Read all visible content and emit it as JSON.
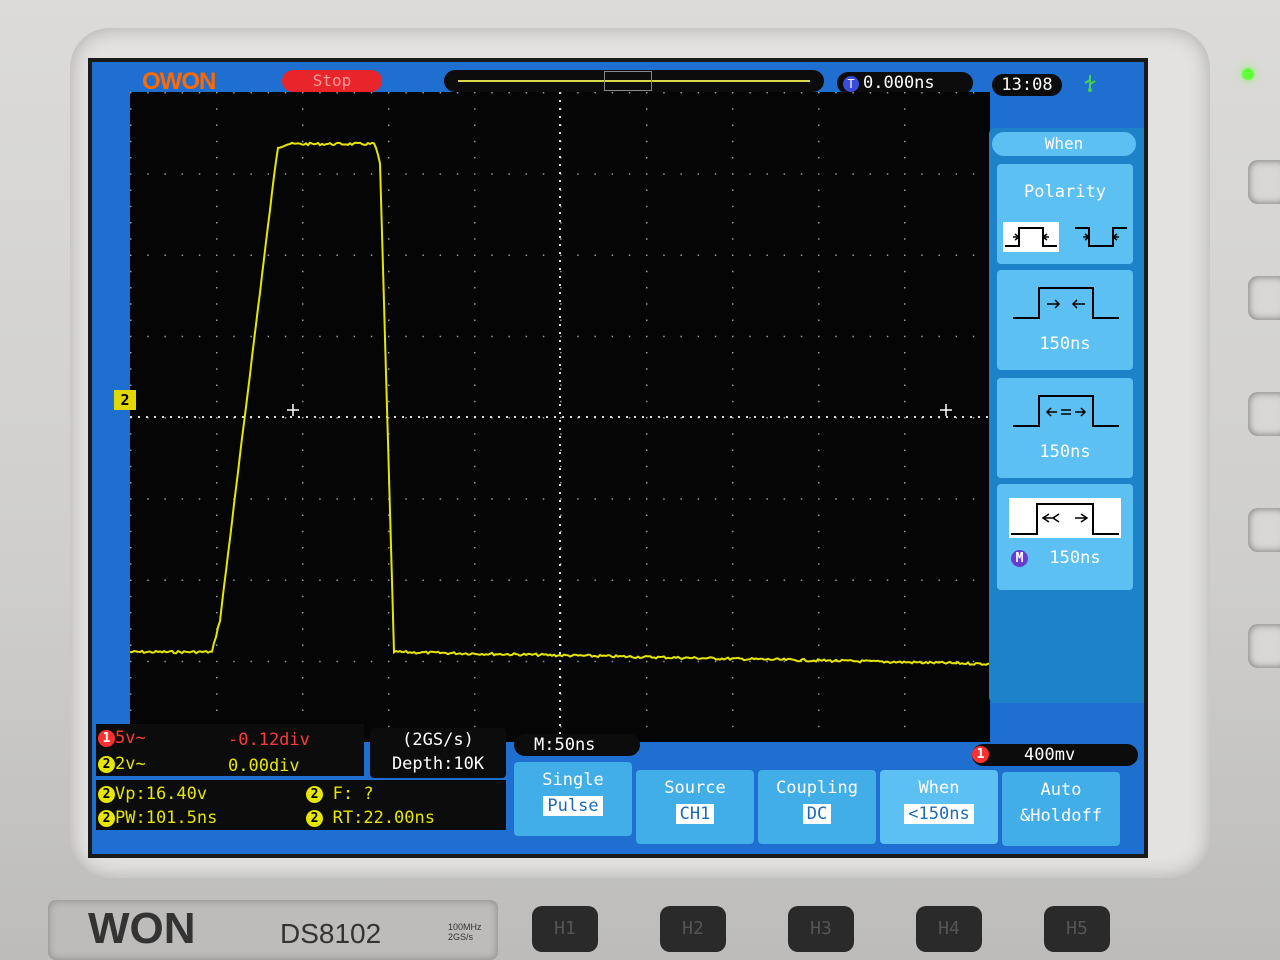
{
  "status": {
    "logo": "OWON",
    "run_state": "Stop",
    "trigger_time": "0.000ns",
    "trigger_time_icon": "T",
    "clock": "13:08",
    "usb_icon": "usb-icon"
  },
  "channel_marker": "2",
  "menu": {
    "title": "When",
    "polarity_label": "Polarity",
    "item1_value": "150ns",
    "item2_value": "150ns",
    "item3_marker": "M",
    "item3_value": "150ns"
  },
  "readouts": {
    "ch1_num": "1",
    "ch1_scale": "5v~",
    "ch1_offset": "-0.12div",
    "ch2_num": "2",
    "ch2_scale": "2v~",
    "ch2_offset": "0.00div",
    "sample_rate": "(2GS/s)",
    "depth": "Depth:10K",
    "timebase": "M:50ns",
    "trig_channel": "1",
    "trig_level": "400mv",
    "meas1": "Vp:16.40v",
    "meas2": "PW:101.5ns",
    "meas3": "F:  ?",
    "meas4": "RT:22.00ns"
  },
  "softkeys": [
    {
      "label": "Single",
      "value": "Pulse"
    },
    {
      "label": "Source",
      "value": "CH1"
    },
    {
      "label": "Coupling",
      "value": "DC"
    },
    {
      "label": "When",
      "value": "<150ns"
    },
    {
      "label": "Auto",
      "value": "&Holdoff"
    }
  ],
  "front_panel": {
    "brand": "WON",
    "model": "DS8102",
    "spec1": "100MHz",
    "spec2": "2GS/s",
    "hbuttons": [
      "H1",
      "H2",
      "H3",
      "H4",
      "H5"
    ]
  },
  "colors": {
    "screen_bg": "#1f6fd0",
    "trace": "#e6e600",
    "stop": "#e8252b",
    "menu": "#5cc0f2"
  }
}
